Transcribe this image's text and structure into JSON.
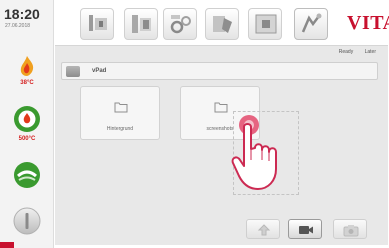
{
  "status": {
    "time": "18:20",
    "date": "27.06.2018",
    "furnace_temp": "38°C",
    "set_temp": "500°C"
  },
  "brand": {
    "logo": "VITA"
  },
  "toolbar": {
    "buttons": [
      "program-icon",
      "program-edit-icon",
      "settings-icon",
      "manual-icon",
      "media-icon",
      "help-icon"
    ]
  },
  "info": {
    "readiness": "Ready",
    "other": "Later"
  },
  "path": {
    "label": "vPad"
  },
  "folders": [
    {
      "name": "Hintergrund"
    },
    {
      "name": "screenshots"
    }
  ],
  "colors": {
    "accent": "#c8102e",
    "temp": "#d42020",
    "green": "#3a9a2f",
    "panel": "#e8e8e8"
  }
}
